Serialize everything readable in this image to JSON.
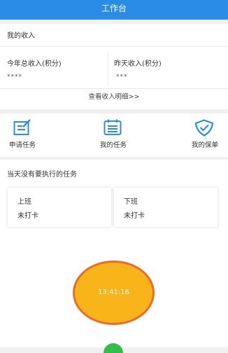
{
  "header": {
    "title": "工作台"
  },
  "income": {
    "title": "我的收入",
    "year_label": "今年总收入(积分)",
    "year_value": "****",
    "yesterday_label": "昨天收入(积分)",
    "yesterday_value": "***",
    "detail_link": "查看收入明细>>"
  },
  "tasks": {
    "items": [
      {
        "label": "申请任务",
        "icon": "edit-icon"
      },
      {
        "label": "我的任务",
        "icon": "calendar-icon"
      },
      {
        "label": "我的保单",
        "icon": "shield-check-icon"
      }
    ],
    "accent": "#2b8ce8"
  },
  "today": {
    "title": "当天没有要执行的任务",
    "clock_in": {
      "label": "上班",
      "status": "未打卡"
    },
    "clock_out": {
      "label": "下班",
      "status": "未打卡"
    }
  },
  "punch": {
    "time": "13:41:16",
    "fill": "#f8b418",
    "ring": "#ec6b2a"
  }
}
